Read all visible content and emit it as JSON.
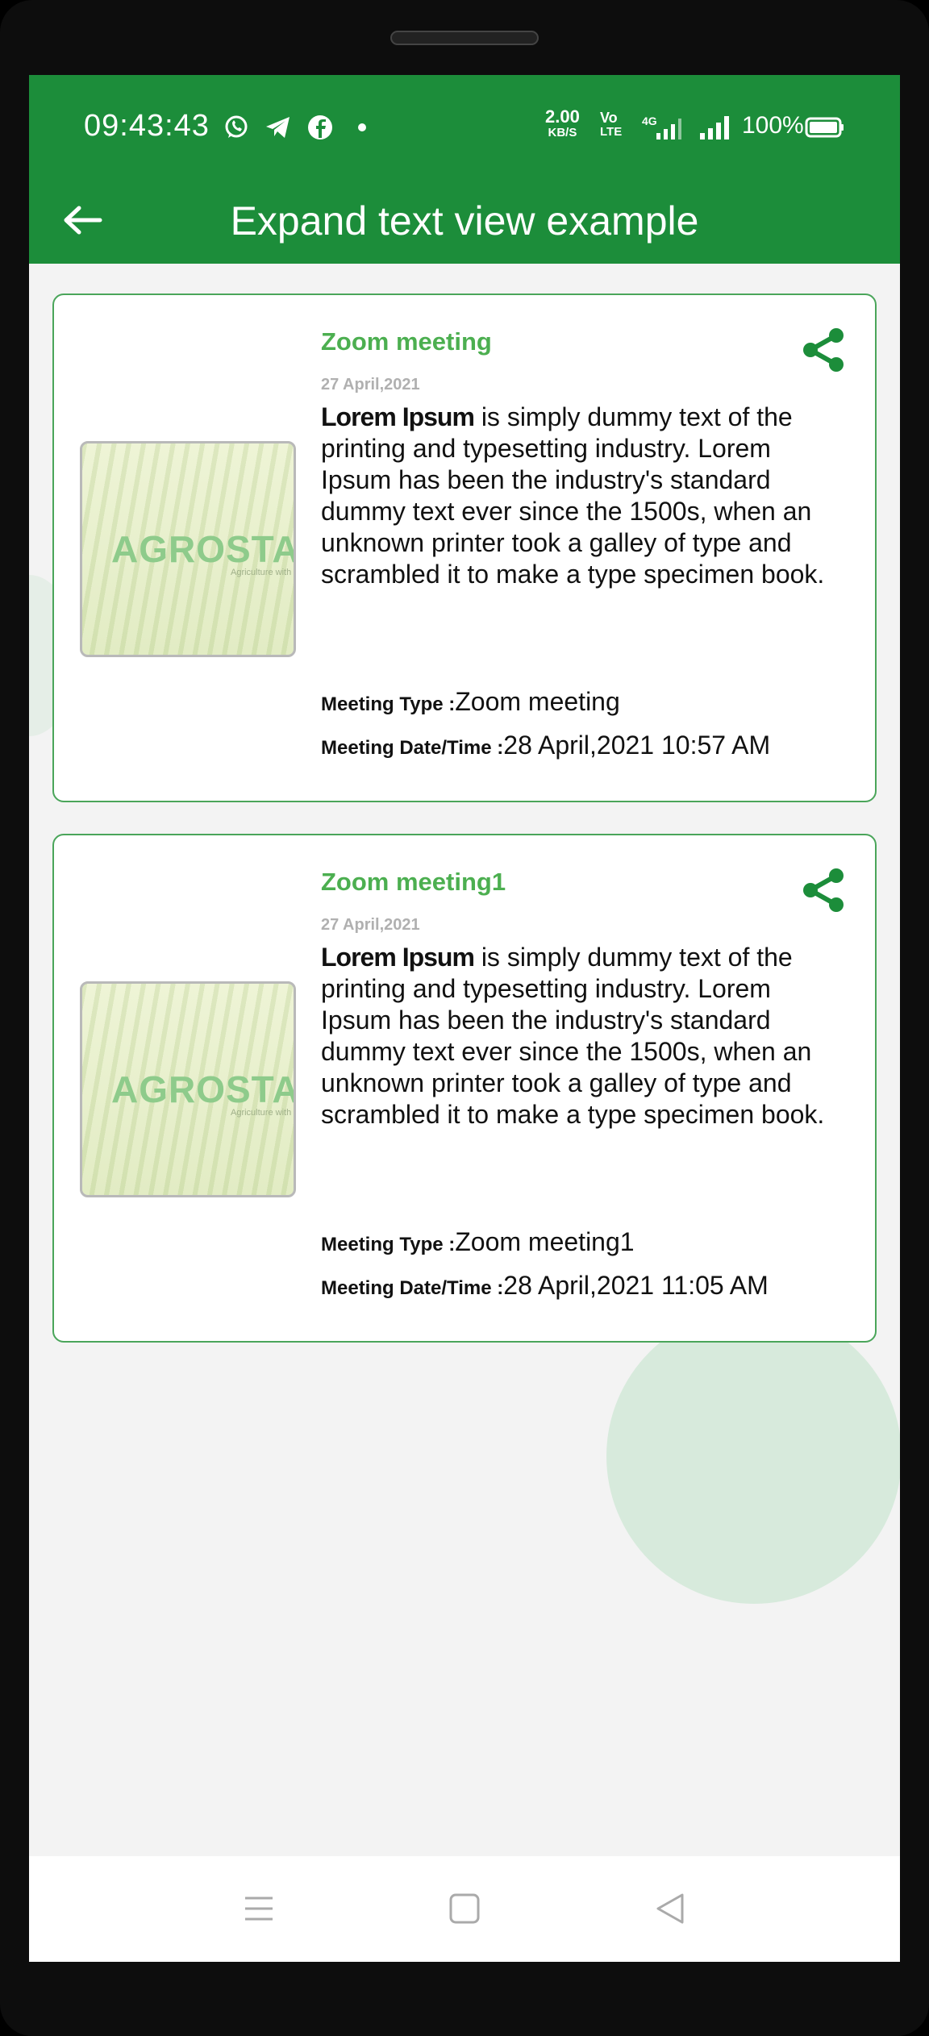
{
  "status_bar": {
    "time": "09:43:43",
    "net_speed_value": "2.00",
    "net_speed_unit": "KB/S",
    "volte_top": "Vo",
    "volte_bottom": "LTE",
    "network": "4G",
    "battery": "100%"
  },
  "app_bar": {
    "title": "Expand text view example"
  },
  "cards": [
    {
      "title": "Zoom meeting",
      "date": "27 April,2021",
      "thumbnail_brand": "AGROSTAR",
      "thumbnail_tagline": "Agriculture with",
      "desc_lead": "Lorem Ipsum",
      "desc_rest": " is simply dummy text of the printing and typesetting industry. Lorem Ipsum has been the industry's standard dummy text ever since the 1500s, when an unknown printer took a galley of type and scrambled it to make a type specimen book.",
      "meeting_type_label": "Meeting Type :",
      "meeting_type_value": "Zoom meeting",
      "meeting_datetime_label": "Meeting Date/Time :",
      "meeting_datetime_value": "28 April,2021  10:57 AM"
    },
    {
      "title": "Zoom meeting1",
      "date": "27 April,2021",
      "thumbnail_brand": "AGROSTAR",
      "thumbnail_tagline": "Agriculture with",
      "desc_lead": "Lorem Ipsum",
      "desc_rest": " is simply dummy text of the printing and typesetting industry. Lorem Ipsum has been the industry's standard dummy text ever since the 1500s, when an unknown printer took a galley of type and scrambled it to make a type specimen book.",
      "meeting_type_label": "Meeting Type :",
      "meeting_type_value": "Zoom meeting1",
      "meeting_datetime_label": "Meeting Date/Time :",
      "meeting_datetime_value": "28 April,2021  11:05 AM"
    }
  ],
  "icons": {
    "back": "arrow-left-icon",
    "share": "share-icon",
    "nav_menu": "menu-icon",
    "nav_home": "square-icon",
    "nav_back": "triangle-back-icon"
  },
  "colors": {
    "primary": "#1c8d3a",
    "card_title": "#4caf50",
    "card_border": "#4aa55a",
    "background": "#f3f3f3"
  }
}
